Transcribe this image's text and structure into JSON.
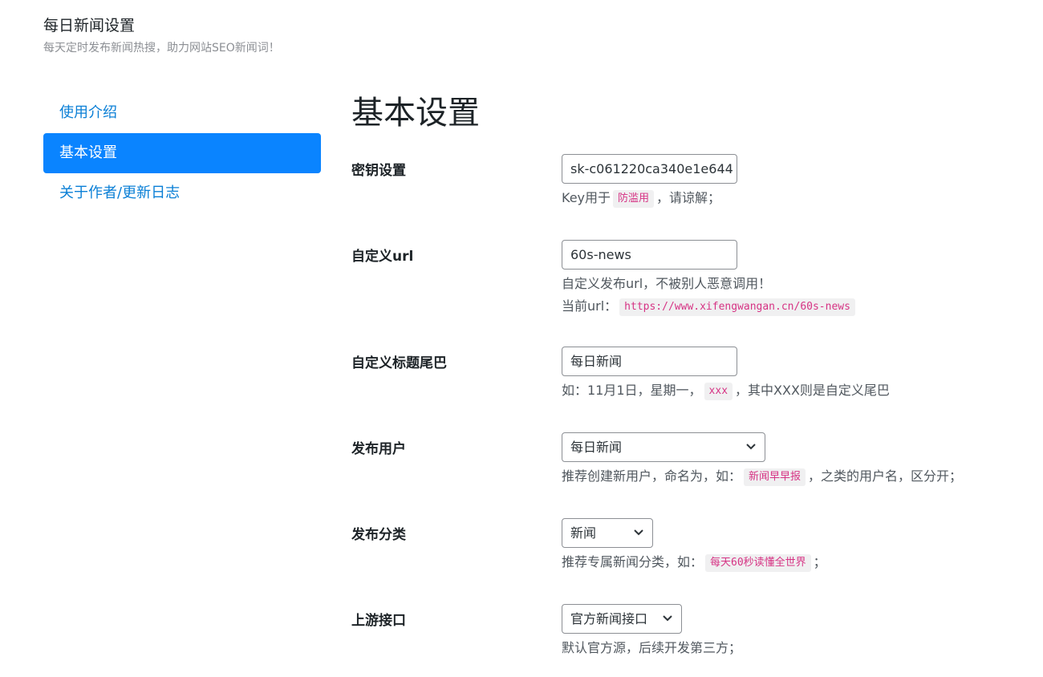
{
  "header": {
    "title": "每日新闻设置",
    "subtitle": "每天定时发布新闻热搜，助力网站SEO新闻词！"
  },
  "sidebar": {
    "items": [
      {
        "label": "使用介绍",
        "active": false
      },
      {
        "label": "基本设置",
        "active": true
      },
      {
        "label": "关于作者/更新日志",
        "active": false
      }
    ]
  },
  "main": {
    "title": "基本设置",
    "fields": {
      "key": {
        "label": "密钥设置",
        "value": "sk-c061220ca340e1e644",
        "desc_before": "Key用于",
        "desc_code": "防滥用",
        "desc_after": "，请谅解；"
      },
      "url": {
        "label": "自定义url",
        "value": "60s-news",
        "desc_line1": "自定义发布url，不被别人恶意调用！",
        "desc_line2_before": "当前url：",
        "desc_line2_code": "https://www.xifengwangan.cn/60s-news"
      },
      "title_suffix": {
        "label": "自定义标题尾巴",
        "value": "每日新闻",
        "desc_before": "如：11月1日，星期一，",
        "desc_code": "xxx",
        "desc_after": "，其中XXX则是自定义尾巴"
      },
      "author": {
        "label": "发布用户",
        "selected": "每日新闻",
        "desc_before": "推荐创建新用户，命名为，如：",
        "desc_code": "新闻早早报",
        "desc_after": "，之类的用户名，区分开；"
      },
      "category": {
        "label": "发布分类",
        "selected": "新闻",
        "desc_before": "推荐专属新闻分类，如：",
        "desc_code": "每天60秒读懂全世界",
        "desc_after": "；"
      },
      "source": {
        "label": "上游接口",
        "selected": "官方新闻接口",
        "desc": "默认官方源，后续开发第三方；"
      }
    }
  },
  "colors": {
    "accent": "#0a84ff",
    "link": "#0a7fd6",
    "code_text": "#d63384",
    "code_bg": "#f0f0f1"
  },
  "icons": {
    "select_arrow": "chevron-down-icon"
  }
}
